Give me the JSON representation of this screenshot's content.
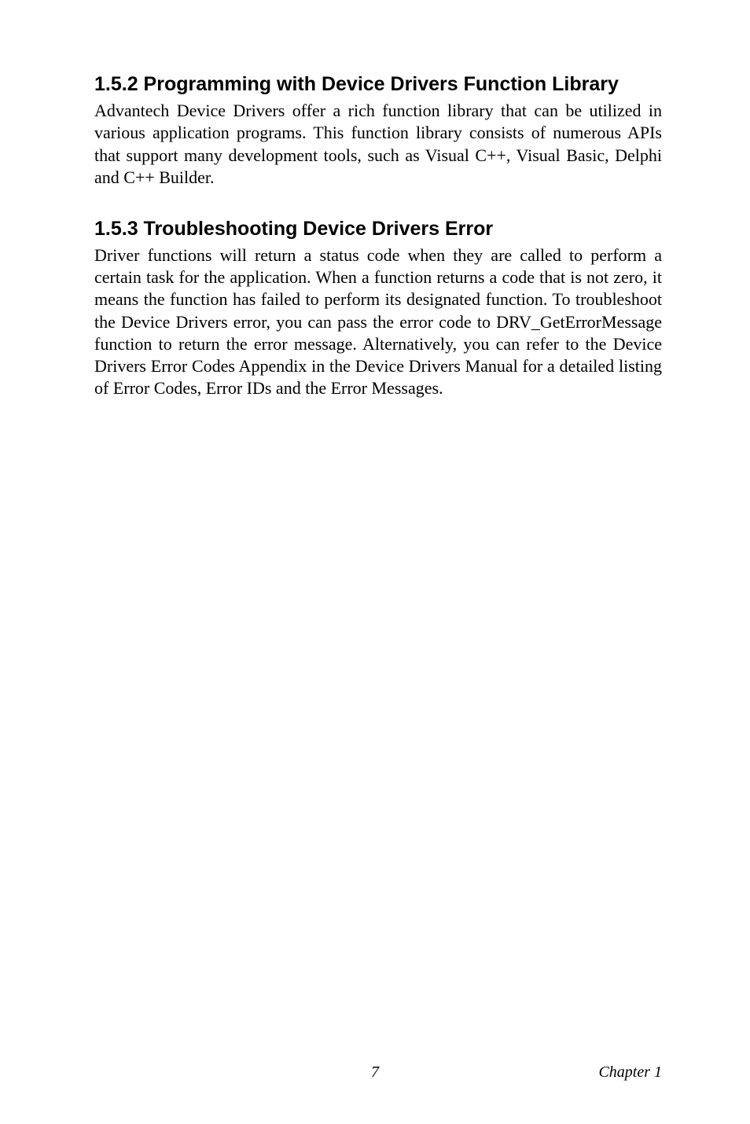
{
  "sections": [
    {
      "heading": "1.5.2 Programming with Device Drivers Function Library",
      "body": "Advantech Device Drivers offer a rich function library that can be utilized in various application programs. This function library consists of numerous APIs that support many development tools, such as Visual C++, Visual Basic, Delphi and C++ Builder."
    },
    {
      "heading": "1.5.3 Troubleshooting Device Drivers Error",
      "body": "Driver functions will return a status code when they are called to perform a certain task for the application. When a function returns a code that is not zero, it means the function has failed to perform its designated function. To troubleshoot the Device Drivers error, you can pass the error code to DRV_GetErrorMessage function to return the error message. Alternatively, you can refer to the Device Drivers Error Codes Appendix in the Device Drivers Manual for a detailed listing of Error Codes, Error IDs and the Error Messages."
    }
  ],
  "footer": {
    "page": "7",
    "chapter": "Chapter 1"
  }
}
